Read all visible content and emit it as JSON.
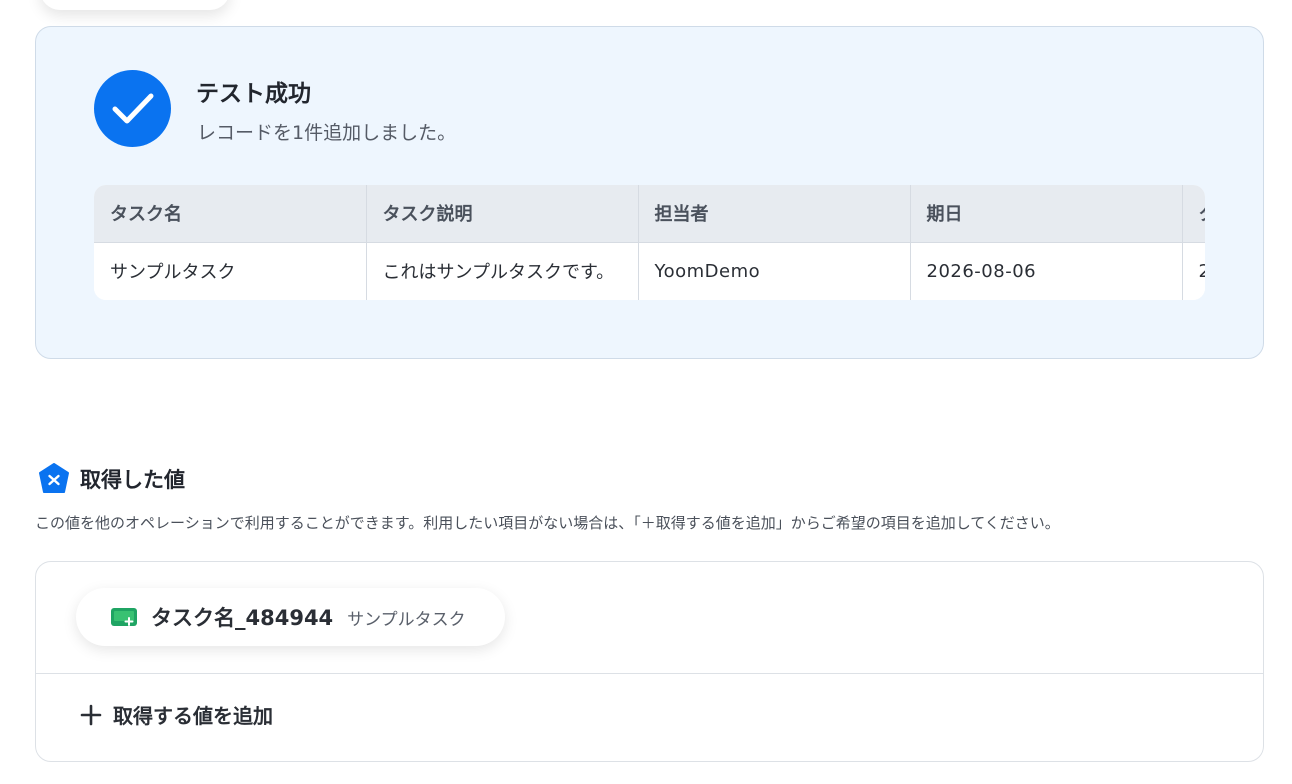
{
  "success": {
    "title": "テスト成功",
    "subtitle": "レコードを1件追加しました。"
  },
  "record_table": {
    "columns": [
      "タスク名",
      "タスク説明",
      "担当者",
      "期日",
      "タ"
    ],
    "rows": [
      [
        "サンプルタスク",
        "これはサンプルタスクです。",
        "YoomDemo",
        "2026-08-06",
        "2"
      ]
    ]
  },
  "retrieved": {
    "title": "取得した値",
    "description": "この値を他のオペレーションで利用することができます。利用したい項目がない場合は、「＋取得する値を追加」からご希望の項目を追加してください。",
    "items": [
      {
        "name": "タスク名_484944",
        "value": "サンプルタスク",
        "icon": "sheet-add-icon"
      }
    ],
    "add_label": "取得する値を追加"
  },
  "colors": {
    "accent": "#0a73f0",
    "panel_bg": "#eef6fe"
  }
}
